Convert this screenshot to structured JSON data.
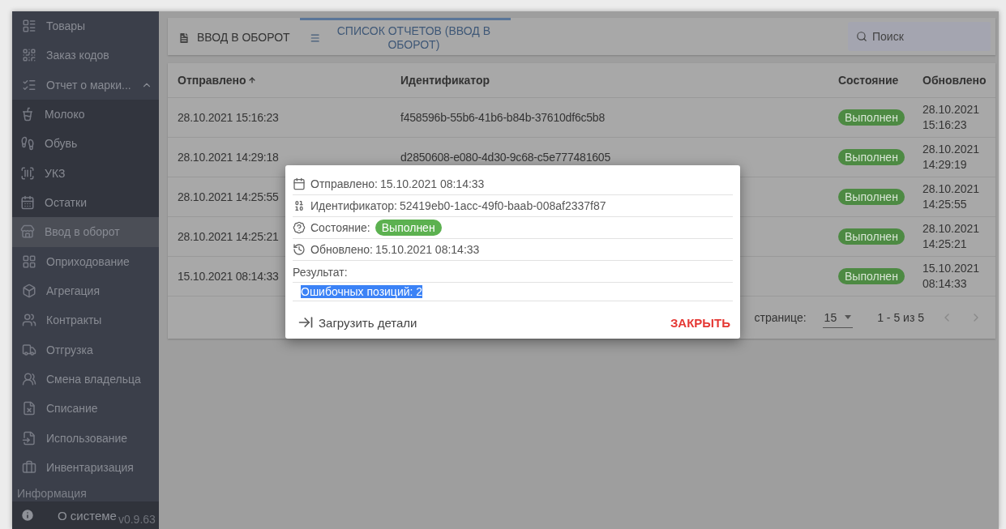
{
  "sidebar": {
    "items": [
      {
        "label": "Товары",
        "selected": false
      },
      {
        "label": "Заказ кодов",
        "selected": false
      },
      {
        "label": "Отчет о марки...",
        "selected": false,
        "expanded": true,
        "children": [
          {
            "label": "Молоко",
            "selected": false
          },
          {
            "label": "Обувь",
            "selected": false
          },
          {
            "label": "УКЗ",
            "selected": false
          },
          {
            "label": "Остатки",
            "selected": false
          },
          {
            "label": "Ввод в оборот",
            "selected": true
          }
        ]
      },
      {
        "label": "Оприходование",
        "selected": false
      },
      {
        "label": "Агрегация",
        "selected": false
      },
      {
        "label": "Контракты",
        "selected": false
      },
      {
        "label": "Отгрузка",
        "selected": false
      },
      {
        "label": "Смена владельца",
        "selected": false
      },
      {
        "label": "Списание",
        "selected": false
      },
      {
        "label": "Использование",
        "selected": false
      },
      {
        "label": "Инвентаризация",
        "selected": false
      }
    ],
    "section": "Информация",
    "info_item": {
      "label": "О системе",
      "version": "v0.9.63"
    }
  },
  "toolbar": {
    "tabs": [
      {
        "label": "ВВОД В ОБОРОТ",
        "selected": false
      },
      {
        "label": "СПИСОК ОТЧЕТОВ (ВВОД В ОБОРОТ)",
        "selected": true
      }
    ],
    "search": {
      "placeholder": "Поиск"
    }
  },
  "table": {
    "columns": [
      {
        "label": "Отправлено",
        "sorted": true
      },
      {
        "label": "Идентификатор",
        "sorted": false
      },
      {
        "label": "Состояние",
        "sorted": false
      },
      {
        "label": "Обновлено",
        "sorted": false
      }
    ],
    "rows": [
      {
        "sent": "28.10.2021 15:16:23",
        "id": "f458596b-55b6-41b6-b84b-37610df6c5b8",
        "status": "Выполнен",
        "updated": "28.10.2021 15:16:23"
      },
      {
        "sent": "28.10.2021 14:29:18",
        "id": "d2850608-e080-4d30-9c68-c5e777481605",
        "status": "Выполнен",
        "updated": "28.10.2021 14:29:19"
      },
      {
        "sent": "28.10.2021 14:25:55",
        "id": "",
        "status": "Выполнен",
        "updated": "28.10.2021 14:25:55"
      },
      {
        "sent": "28.10.2021 14:25:21",
        "id": "",
        "status": "Выполнен",
        "updated": "28.10.2021 14:25:21"
      },
      {
        "sent": "15.10.2021 08:14:33",
        "id": "",
        "status": "Выполнен",
        "updated": "15.10.2021 08:14:33"
      }
    ],
    "footer": {
      "rows_per_page_label": "странице:",
      "rows_per_page": "15",
      "range": "1 - 5 из 5"
    }
  },
  "dialog": {
    "fields": [
      {
        "kind": "sent",
        "label": "Отправлено:",
        "value": "15.10.2021 08:14:33"
      },
      {
        "kind": "id",
        "label": "Идентификатор:",
        "value": "52419eb0-1acc-49f0-baab-008af2337f87"
      },
      {
        "kind": "status",
        "label": "Состояние:",
        "value": "Выполнен"
      },
      {
        "kind": "updated",
        "label": "Обновлено:",
        "value": "15.10.2021 08:14:33"
      }
    ],
    "result_label": "Результат:",
    "result_value": "Ошибочных позиций: 2",
    "actions": {
      "load": "Загрузить детали",
      "close": "ЗАКРЫТЬ"
    }
  }
}
